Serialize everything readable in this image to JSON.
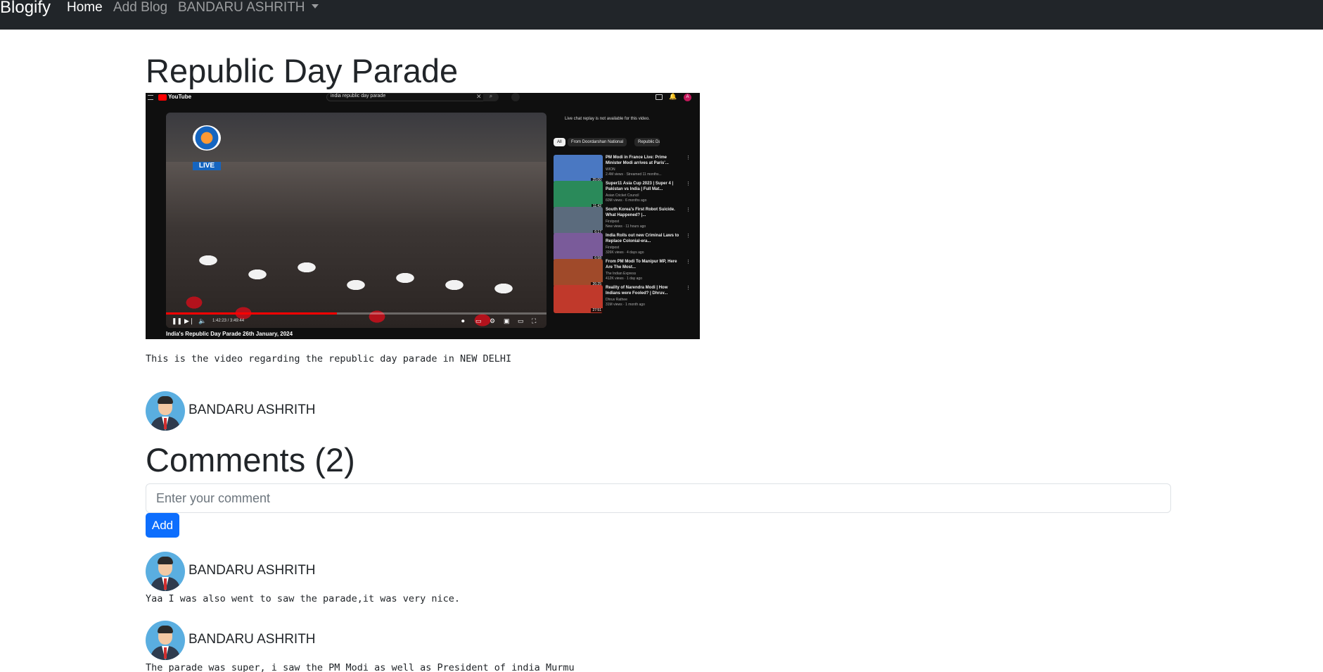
{
  "nav": {
    "brand": "Blogify",
    "home": "Home",
    "add_blog": "Add Blog",
    "user": "BANDARU ASHRITH"
  },
  "blog": {
    "title": "Republic Day Parade",
    "description": "This is the video regarding the republic day parade in NEW DELHI",
    "author": "BANDARU ASHRITH"
  },
  "video": {
    "logo": "YouTube",
    "search_query": "india republic day parade",
    "channel_badge": "LIVE",
    "time": "1:42:23 / 3:49:44",
    "progress": 0.45,
    "caption": "India's Republic Day Parade 26th January, 2024",
    "avatar_letter": "A",
    "chat_note": "Live chat replay is not available for this video.",
    "chips": [
      "All",
      "From Doordarshan National",
      "Republic Day"
    ],
    "recommendations": [
      {
        "title": "PM Modi in France Live: Prime Minister Modi arrives at Paris'...",
        "channel": "WION",
        "meta": "2.4M views · Streamed 11 months...",
        "duration": "25:00",
        "color": "#4a78c2"
      },
      {
        "title": "Super11 Asia Cup 2023 | Super 4 | Pakistan vs India | Full Mat...",
        "channel": "Asian Cricket Council",
        "meta": "60M views · 6 months ago",
        "duration": "11:42",
        "color": "#2a8a5a"
      },
      {
        "title": "South Korea's First Robot Suicide. What Happened? |...",
        "channel": "Firstpost",
        "meta": "New views · 11 hours ago",
        "duration": "6:17",
        "color": "#5b6b7d"
      },
      {
        "title": "India Rolls out new Criminal Laws to Replace Colonial-era...",
        "channel": "Firstpost",
        "meta": "326K views · 4 days ago",
        "duration": "6:58",
        "color": "#7a5b9a"
      },
      {
        "title": "From PM Modi To Manipur MP, Here Are The Most...",
        "channel": "The Indian Express",
        "meta": "412K views · 1 day ago",
        "duration": "26:25",
        "color": "#a04a2a"
      },
      {
        "title": "Reality of Narendra Modi | How Indians were Fooled? | Dhruv...",
        "channel": "Dhruv Rathee",
        "meta": "31M views · 1 month ago",
        "duration": "27:51",
        "color": "#c0392b"
      }
    ]
  },
  "comments": {
    "title": "Comments (2)",
    "placeholder": "Enter your comment",
    "add_label": "Add",
    "items": [
      {
        "author": "BANDARU ASHRITH",
        "text": "Yaa I was also went to saw the parade,it was very nice."
      },
      {
        "author": "BANDARU ASHRITH",
        "text": "The parade was super, i saw the PM Modi as well as President of india Murmu"
      }
    ]
  }
}
